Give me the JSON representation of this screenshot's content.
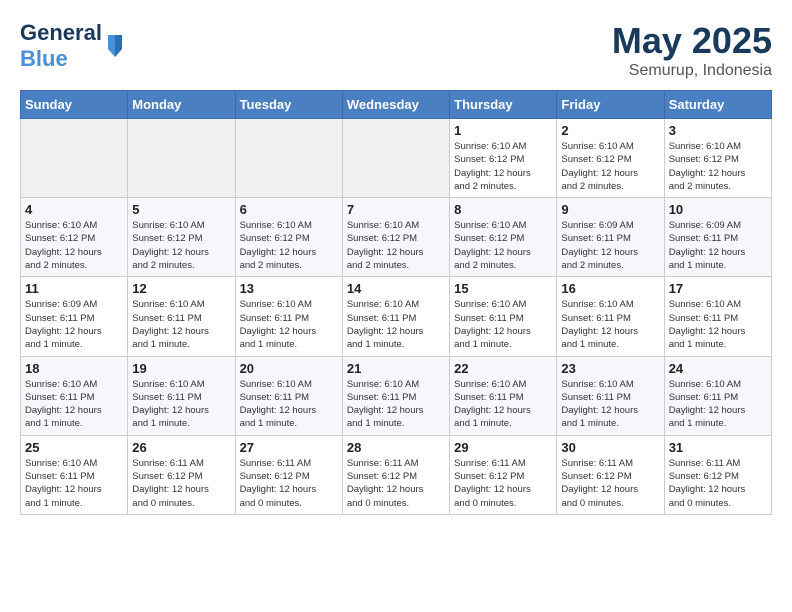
{
  "header": {
    "logo_text1": "General",
    "logo_text2": "Blue",
    "month": "May 2025",
    "location": "Semurup, Indonesia"
  },
  "weekdays": [
    "Sunday",
    "Monday",
    "Tuesday",
    "Wednesday",
    "Thursday",
    "Friday",
    "Saturday"
  ],
  "weeks": [
    [
      {
        "day": "",
        "info": ""
      },
      {
        "day": "",
        "info": ""
      },
      {
        "day": "",
        "info": ""
      },
      {
        "day": "",
        "info": ""
      },
      {
        "day": "1",
        "info": "Sunrise: 6:10 AM\nSunset: 6:12 PM\nDaylight: 12 hours\nand 2 minutes."
      },
      {
        "day": "2",
        "info": "Sunrise: 6:10 AM\nSunset: 6:12 PM\nDaylight: 12 hours\nand 2 minutes."
      },
      {
        "day": "3",
        "info": "Sunrise: 6:10 AM\nSunset: 6:12 PM\nDaylight: 12 hours\nand 2 minutes."
      }
    ],
    [
      {
        "day": "4",
        "info": "Sunrise: 6:10 AM\nSunset: 6:12 PM\nDaylight: 12 hours\nand 2 minutes."
      },
      {
        "day": "5",
        "info": "Sunrise: 6:10 AM\nSunset: 6:12 PM\nDaylight: 12 hours\nand 2 minutes."
      },
      {
        "day": "6",
        "info": "Sunrise: 6:10 AM\nSunset: 6:12 PM\nDaylight: 12 hours\nand 2 minutes."
      },
      {
        "day": "7",
        "info": "Sunrise: 6:10 AM\nSunset: 6:12 PM\nDaylight: 12 hours\nand 2 minutes."
      },
      {
        "day": "8",
        "info": "Sunrise: 6:10 AM\nSunset: 6:12 PM\nDaylight: 12 hours\nand 2 minutes."
      },
      {
        "day": "9",
        "info": "Sunrise: 6:09 AM\nSunset: 6:11 PM\nDaylight: 12 hours\nand 2 minutes."
      },
      {
        "day": "10",
        "info": "Sunrise: 6:09 AM\nSunset: 6:11 PM\nDaylight: 12 hours\nand 1 minute."
      }
    ],
    [
      {
        "day": "11",
        "info": "Sunrise: 6:09 AM\nSunset: 6:11 PM\nDaylight: 12 hours\nand 1 minute."
      },
      {
        "day": "12",
        "info": "Sunrise: 6:10 AM\nSunset: 6:11 PM\nDaylight: 12 hours\nand 1 minute."
      },
      {
        "day": "13",
        "info": "Sunrise: 6:10 AM\nSunset: 6:11 PM\nDaylight: 12 hours\nand 1 minute."
      },
      {
        "day": "14",
        "info": "Sunrise: 6:10 AM\nSunset: 6:11 PM\nDaylight: 12 hours\nand 1 minute."
      },
      {
        "day": "15",
        "info": "Sunrise: 6:10 AM\nSunset: 6:11 PM\nDaylight: 12 hours\nand 1 minute."
      },
      {
        "day": "16",
        "info": "Sunrise: 6:10 AM\nSunset: 6:11 PM\nDaylight: 12 hours\nand 1 minute."
      },
      {
        "day": "17",
        "info": "Sunrise: 6:10 AM\nSunset: 6:11 PM\nDaylight: 12 hours\nand 1 minute."
      }
    ],
    [
      {
        "day": "18",
        "info": "Sunrise: 6:10 AM\nSunset: 6:11 PM\nDaylight: 12 hours\nand 1 minute."
      },
      {
        "day": "19",
        "info": "Sunrise: 6:10 AM\nSunset: 6:11 PM\nDaylight: 12 hours\nand 1 minute."
      },
      {
        "day": "20",
        "info": "Sunrise: 6:10 AM\nSunset: 6:11 PM\nDaylight: 12 hours\nand 1 minute."
      },
      {
        "day": "21",
        "info": "Sunrise: 6:10 AM\nSunset: 6:11 PM\nDaylight: 12 hours\nand 1 minute."
      },
      {
        "day": "22",
        "info": "Sunrise: 6:10 AM\nSunset: 6:11 PM\nDaylight: 12 hours\nand 1 minute."
      },
      {
        "day": "23",
        "info": "Sunrise: 6:10 AM\nSunset: 6:11 PM\nDaylight: 12 hours\nand 1 minute."
      },
      {
        "day": "24",
        "info": "Sunrise: 6:10 AM\nSunset: 6:11 PM\nDaylight: 12 hours\nand 1 minute."
      }
    ],
    [
      {
        "day": "25",
        "info": "Sunrise: 6:10 AM\nSunset: 6:11 PM\nDaylight: 12 hours\nand 1 minute."
      },
      {
        "day": "26",
        "info": "Sunrise: 6:11 AM\nSunset: 6:12 PM\nDaylight: 12 hours\nand 0 minutes."
      },
      {
        "day": "27",
        "info": "Sunrise: 6:11 AM\nSunset: 6:12 PM\nDaylight: 12 hours\nand 0 minutes."
      },
      {
        "day": "28",
        "info": "Sunrise: 6:11 AM\nSunset: 6:12 PM\nDaylight: 12 hours\nand 0 minutes."
      },
      {
        "day": "29",
        "info": "Sunrise: 6:11 AM\nSunset: 6:12 PM\nDaylight: 12 hours\nand 0 minutes."
      },
      {
        "day": "30",
        "info": "Sunrise: 6:11 AM\nSunset: 6:12 PM\nDaylight: 12 hours\nand 0 minutes."
      },
      {
        "day": "31",
        "info": "Sunrise: 6:11 AM\nSunset: 6:12 PM\nDaylight: 12 hours\nand 0 minutes."
      }
    ]
  ]
}
